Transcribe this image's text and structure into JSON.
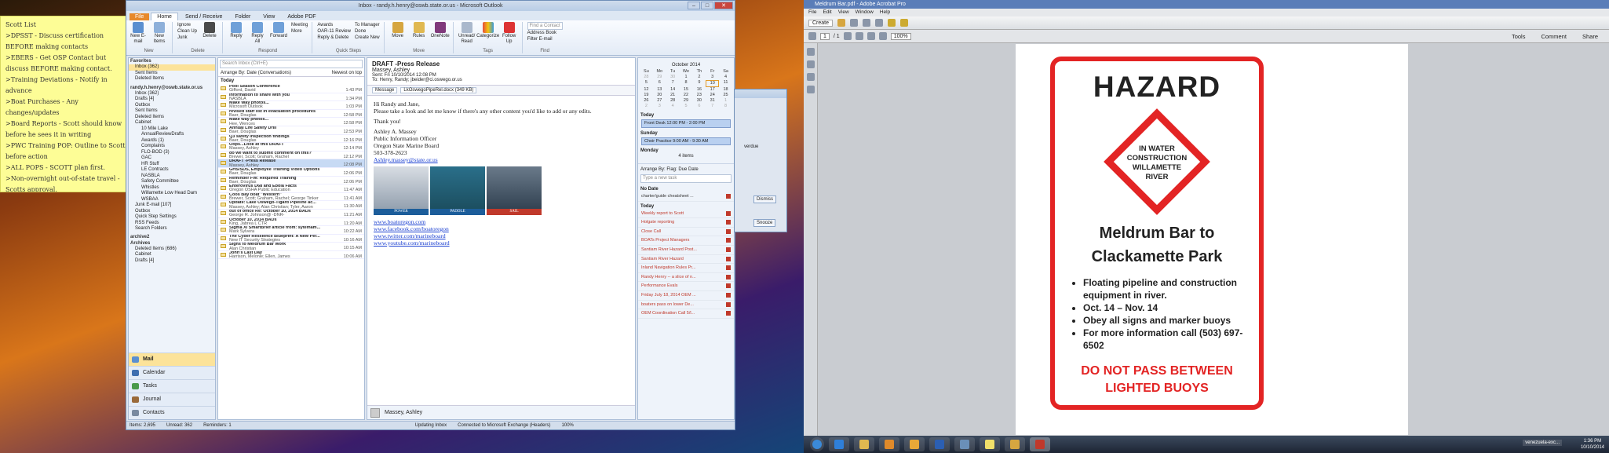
{
  "sticky": {
    "lines": [
      "Scott List",
      ">DPSST - Discuss certification BEFORE making contacts",
      ">EBERS - Get OSP Contact but discuss BEFORE making contact.",
      ">Training Deviations - Notify in advance",
      ">Boat Purchases - Any changes/updates",
      ">Board Reports - Scott should know before he sees it in writing",
      ">PWC Training POP: Outline to Scott before action",
      ">ALL POPS - SCOTT plan first.",
      ">Non-overnight out-of-state travel - Scotts approval."
    ]
  },
  "outlook": {
    "title": "Inbox - randy.h.henry@oswb.state.or.us - Microsoft Outlook",
    "tabs": [
      "File",
      "Home",
      "Send / Receive",
      "Folder",
      "View",
      "Adobe PDF"
    ],
    "ribbon": {
      "new": [
        "New E-mail",
        "New Items"
      ],
      "delete": [
        "Ignore",
        "Clean Up",
        "Junk",
        "Delete"
      ],
      "respond": [
        "Reply",
        "Reply All",
        "Forward",
        "Meeting",
        "More"
      ],
      "quicksteps": [
        "Awards",
        "OAR-11 Review",
        "Reply & Delete",
        "To Manager",
        "Done",
        "Create New"
      ],
      "move": [
        "Move",
        "Rules",
        "OneNote"
      ],
      "tags": [
        "Unread/ Read",
        "Categorize",
        "Follow Up"
      ],
      "find": [
        "Find a Contact",
        "Address Book",
        "Filter E-mail"
      ],
      "group_labels": [
        "New",
        "Delete",
        "Respond",
        "Quick Steps",
        "Move",
        "Tags",
        "Find"
      ]
    },
    "nav": {
      "favorites_label": "Favorites",
      "favorites": [
        "Inbox (362)",
        "Sent Items",
        "Deleted Items"
      ],
      "account": "randy.h.henry@oswb.state.or.us",
      "folders": [
        "Inbox (362)",
        "Drafts [4]",
        "Outbox",
        "Sent Items",
        "Deleted Items",
        "Cabinet",
        "10 Mile Lake",
        "AnnualReviewDrafts",
        "Awards (1)",
        "Complaints",
        "FLO-BOD (3)",
        "GAC",
        "HR Stuff",
        "LE Contracts",
        "NASBLA",
        "Safety Committee",
        "Whistles",
        "Willamette Low Head Dam",
        "WSBAA",
        "Junk E-mail [107]",
        "Outbox",
        "Quick Step Settings",
        "RSS Feeds",
        "Search Folders",
        "archive2",
        "Archives",
        "Deleted Items (686)",
        "Cabinet",
        "Drafts [4]"
      ],
      "buttons": [
        "Mail",
        "Calendar",
        "Tasks",
        "Journal",
        "Contacts"
      ]
    },
    "list": {
      "search_placeholder": "Search Inbox (Ctrl+E)",
      "arrange": "Arrange By: Date (Conversations)",
      "sort": "Newest on top",
      "group": "Today",
      "mails": [
        {
          "subject": "Pool Season Conference",
          "from": "Gifford, David",
          "time": "1:43 PM"
        },
        {
          "subject": "Information to share with you",
          "from": "NASBLA",
          "time": "1:34 PM"
        },
        {
          "subject": "Make Way photos...",
          "from": "Microsoft Outlook",
          "time": "1:03 PM"
        },
        {
          "subject": "revised staff list in evacuation procedures",
          "from": "Baer, Douglas",
          "time": "12:58 PM"
        },
        {
          "subject": "Make way photos...",
          "from": "Hee, Wences",
          "time": "12:58 PM"
        },
        {
          "subject": "Annual Life Safety Drill",
          "from": "Baer, Douglas",
          "time": "12:53 PM"
        },
        {
          "subject": "Q3 safety inspection findings",
          "from": "Baer, Douglas",
          "time": "12:16 PM"
        },
        {
          "subject": "Oops...Look at this DRAFT",
          "from": "Massey, Ashley",
          "time": "12:14 PM"
        },
        {
          "subject": "do we want to submit comment on this?",
          "from": "Brewer, Scott; Graham, Rachel",
          "time": "12:12 PM"
        },
        {
          "subject": "DRAFT -Press Release",
          "from": "Massey, Ashley",
          "time": "12:08 PM"
        },
        {
          "subject": "GHS/SDS, Employee Training Video Options",
          "from": "Baer, Douglas",
          "time": "12:06 PM"
        },
        {
          "subject": "Reminder FW: Required Training",
          "from": "Baer, Douglas",
          "time": "12:06 PM"
        },
        {
          "subject": "Enterovirus D68 and Ebola Facts",
          "from": "Oregon OSHA Public Education",
          "time": "11:47 AM"
        },
        {
          "subject": "Coos Bay boat \"Western\"",
          "from": "Brewer, Scott; Graham, Rachel; George Tinker",
          "time": "11:41 AM"
        },
        {
          "subject": "Update: Lake Oswego-Tigard Pipeline ac...",
          "from": "Massey, Ashley; Alan Christian; Tyler, Aaron",
          "time": "11:30 AM"
        },
        {
          "subject": "out of office Re: October 10, 2014 BADs",
          "from": "George R. Johnson@ -DNR-",
          "time": "11:21 AM"
        },
        {
          "subject": "October 10, 2014 BADs",
          "from": "King, Jabrea L CTR",
          "time": "11:20 AM"
        },
        {
          "subject": "Sigma XI SmartBrief article from: sytemam...",
          "from": "Mark Sylvera",
          "time": "10:22 AM"
        },
        {
          "subject": "The Cyber Resilience Blueprint: A New Per...",
          "from": "New IT Security Strategies",
          "time": "10:16 AM"
        },
        {
          "subject": "Signs to Meldrum Bar Work",
          "from": "Alan Christian",
          "time": "10:15 AM"
        },
        {
          "subject": "John's Last Day",
          "from": "Harrison, Melonie; Ellen, James",
          "time": "10:06 AM"
        }
      ]
    },
    "reading": {
      "subject": "DRAFT -Press Release",
      "sender": "Massey, Ashley",
      "sent": "Sent:   Fri 10/10/2014 12:08 PM",
      "to": "To:   Henry, Randy; jbeider@ci.oswego.or.us",
      "attachments": [
        "Message",
        "LkOswegoPipeRel.docx (349 KB)"
      ],
      "greeting": "Hi Randy and Jane,",
      "body": "Please take a look and let me know if there's any other content you'd like to add or any edits.",
      "thanks": "Thank you!",
      "sig": [
        "Ashley A. Massey",
        "Public Information Officer",
        "Oregon State Marine Board",
        "503-378-2623"
      ],
      "email": "Ashley.massey@state.or.us",
      "image_labels": [
        "POWER",
        "PADDLE",
        "SAIL"
      ],
      "links": [
        "www.boatoregon.com",
        "www.facebook.com/boatoregon",
        "www.twitter.com/marineboard",
        "www.youtube.com/marineboard"
      ],
      "person": "Massey, Ashley"
    },
    "todo": {
      "month": "October 2014",
      "days": [
        "Su",
        "Mo",
        "Tu",
        "We",
        "Th",
        "Fr",
        "Sa"
      ],
      "dates": [
        "28",
        "29",
        "30",
        "1",
        "2",
        "3",
        "4",
        "5",
        "6",
        "7",
        "8",
        "9",
        "10",
        "11",
        "12",
        "13",
        "14",
        "15",
        "16",
        "17",
        "18",
        "19",
        "20",
        "21",
        "22",
        "23",
        "24",
        "25",
        "26",
        "27",
        "28",
        "29",
        "30",
        "31",
        "1",
        "2",
        "3",
        "4",
        "5",
        "6",
        "7",
        "8"
      ],
      "today_label": "Today",
      "today_appt": "Front Desk 12:00 PM - 2:00 PM",
      "sunday_label": "Sunday",
      "sunday_appt": "Choir Practice 9:00 AM - 9:30 AM",
      "monday_label": "Monday",
      "items_count": "4 items",
      "arrange": "Arrange By: Flag: Due Date",
      "task_placeholder": "Type a new task",
      "no_date": "No Date",
      "no_date_task": "charter/guide cheatsheet ...",
      "today_group": "Today",
      "tasks": [
        "Weekly report to Scott",
        "Holgate reporting",
        "Close Call",
        "BOATs Project Managers",
        "Santiam River Hazard Post...",
        "Santiam River Hazard",
        "Inland Navigation Rules Pr...",
        "Randy Henry -- a slice of n...",
        "Performance Evals",
        "Friday July 18, 2014 OEM ...",
        "boaters pass on lower De...",
        "OEM Coordination Call 5/l..."
      ]
    },
    "status": [
      "Items: 2,695",
      "Unread: 362",
      "Reminders: 1",
      "Updating Inbox",
      "Connected to Microsoft Exchange (Headers)",
      "100%"
    ]
  },
  "reminder": {
    "overdue": "verdue",
    "dismiss": "Dismiss",
    "snooze": "Snooze"
  },
  "acrobat": {
    "title": "Meldrum Bar.pdf - Adobe Acrobat Pro",
    "menu": [
      "File",
      "Edit",
      "View",
      "Window",
      "Help"
    ],
    "create": "Create",
    "page_num": "1",
    "page_total": "/ 1",
    "zoom": "100%",
    "right_links": [
      "Tools",
      "Comment",
      "Share"
    ]
  },
  "sign": {
    "title": "HAZARD",
    "diamond": [
      "IN WATER",
      "CONSTRUCTION",
      "WILLAMETTE",
      "RIVER"
    ],
    "place": [
      "Meldrum Bar to",
      "Clackamette Park"
    ],
    "bullets": [
      "Floating pipeline and construction equipment in river.",
      "Oct. 14 – Nov. 14",
      "Obey all signs and marker buoys",
      "For more information call (503) 697-6502"
    ],
    "warning": [
      "DO NOT PASS BETWEEN",
      "LIGHTED BUOYS"
    ]
  },
  "taskbar": {
    "tray_text": "venezuela-exc...",
    "time": "1:36 PM",
    "date": "10/10/2014"
  }
}
